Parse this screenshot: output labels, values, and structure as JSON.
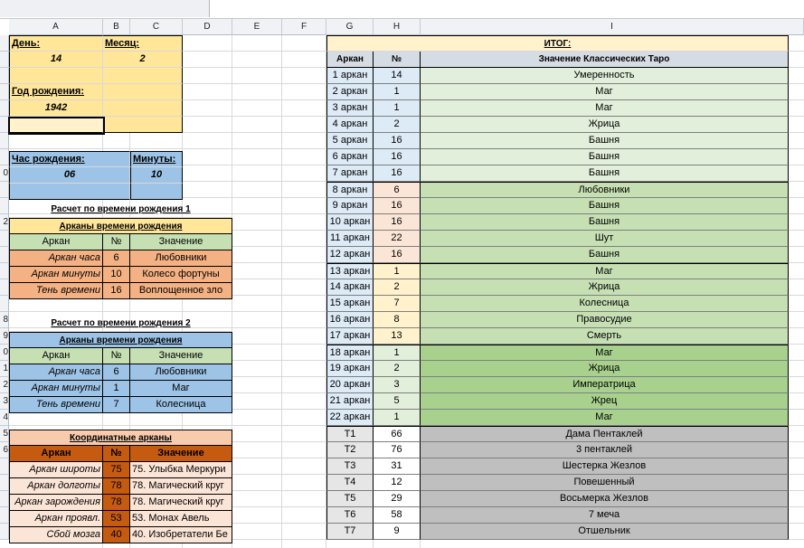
{
  "columns": [
    "A",
    "B",
    "C",
    "D",
    "E",
    "F",
    "G",
    "H",
    "I"
  ],
  "rows": [
    "",
    "",
    "",
    "",
    "",
    "",
    "",
    "",
    "0",
    "",
    "",
    "2",
    "",
    "",
    "",
    "",
    "",
    "8",
    "9",
    "0",
    "1",
    "2",
    "3",
    "4",
    "5",
    "6",
    "",
    "",
    "",
    "",
    ""
  ],
  "left": {
    "day_label": "День:",
    "day_value": "14",
    "month_label": "Месяц:",
    "month_value": "2",
    "year_label": "Год рождения:",
    "year_value": "1942",
    "hour_label": "Час рождения:",
    "hour_value": "06",
    "minutes_label": "Минуты:",
    "minutes_value": "10",
    "calc1_title": "Расчет по времени рождения 1",
    "calc1_header": "Арканы времени рождения",
    "calc1_cols": [
      "Аркан",
      "№",
      "Значение"
    ],
    "calc1_rows": [
      [
        "Аркан часа",
        "6",
        "Любовники"
      ],
      [
        "Аркан минуты",
        "10",
        "Колесо фортуны"
      ],
      [
        "Тень времени",
        "16",
        "Воплощенное зло"
      ]
    ],
    "calc2_title": "Расчет по времени рождения 2",
    "calc2_header": "Арканы времени рождения",
    "calc2_cols": [
      "Аркан",
      "№",
      "Значение"
    ],
    "calc2_rows": [
      [
        "Аркан часа",
        "6",
        "Любовники"
      ],
      [
        "Аркан минуты",
        "1",
        "Маг"
      ],
      [
        "Тень времени",
        "7",
        "Колесница"
      ]
    ],
    "coord_header": "Координатные арканы",
    "coord_cols": [
      "Аркан",
      "№",
      "Значение"
    ],
    "coord_rows": [
      [
        "Аркан широты",
        "75",
        "75. Улыбка Меркури"
      ],
      [
        "Аркан долготы",
        "78",
        "78. Магический круг"
      ],
      [
        "Аркан зарождения",
        "78",
        "78. Магический круг"
      ],
      [
        "Аркан проявл.",
        "53",
        "53. Монах Авель"
      ],
      [
        "Сбой мозга",
        "40",
        "40. Изобретатели Бе"
      ]
    ]
  },
  "right": {
    "title": "ИТОГ:",
    "cols": [
      "Аркан",
      "№",
      "Значение Классических Таро"
    ],
    "rows": [
      [
        "1 аркан",
        "14",
        "Умеренность"
      ],
      [
        "2 аркан",
        "1",
        "Маг"
      ],
      [
        "3 аркан",
        "1",
        "Маг"
      ],
      [
        "4 аркан",
        "2",
        "Жрица"
      ],
      [
        "5 аркан",
        "16",
        "Башня"
      ],
      [
        "6 аркан",
        "16",
        "Башня"
      ],
      [
        "7 аркан",
        "16",
        "Башня"
      ],
      [
        "8 аркан",
        "6",
        "Любовники"
      ],
      [
        "9 аркан",
        "16",
        "Башня"
      ],
      [
        "10 аркан",
        "16",
        "Башня"
      ],
      [
        "11 аркан",
        "22",
        "Шут"
      ],
      [
        "12 аркан",
        "16",
        "Башня"
      ],
      [
        "13 аркан",
        "1",
        "Маг"
      ],
      [
        "14 аркан",
        "2",
        "Жрица"
      ],
      [
        "15 аркан",
        "7",
        "Колесница"
      ],
      [
        "16 аркан",
        "8",
        "Правосудие"
      ],
      [
        "17 аркан",
        "13",
        "Смерть"
      ],
      [
        "18 аркан",
        "1",
        "Маг"
      ],
      [
        "19 аркан",
        "2",
        "Жрица"
      ],
      [
        "20 аркан",
        "3",
        "Императрица"
      ],
      [
        "21 аркан",
        "5",
        "Жрец"
      ],
      [
        "22 аркан",
        "1",
        "Маг"
      ],
      [
        "T1",
        "66",
        "Дама Пентаклей"
      ],
      [
        "T2",
        "76",
        "3 пентаклей"
      ],
      [
        "T3",
        "31",
        "Шестерка Жезлов"
      ],
      [
        "T4",
        "12",
        "Повешенный"
      ],
      [
        "T5",
        "29",
        "Восьмерка Жезлов"
      ],
      [
        "T6",
        "58",
        "7 меча"
      ],
      [
        "T7",
        "9",
        "Отшельник"
      ]
    ]
  },
  "colors": {
    "yellow": "#ffe699",
    "light_yellow": "#fff2cc",
    "blue": "#9dc3e6",
    "light_blue": "#ddebf7",
    "orange": "#f4b183",
    "dark_orange": "#c55a11",
    "light_orange": "#fbe5d6",
    "green_light": "#e2efda",
    "green_mid": "#c6e0b4",
    "green": "#a9d18e",
    "gray": "#bfbfbf",
    "header_blue": "#d6dce4"
  }
}
